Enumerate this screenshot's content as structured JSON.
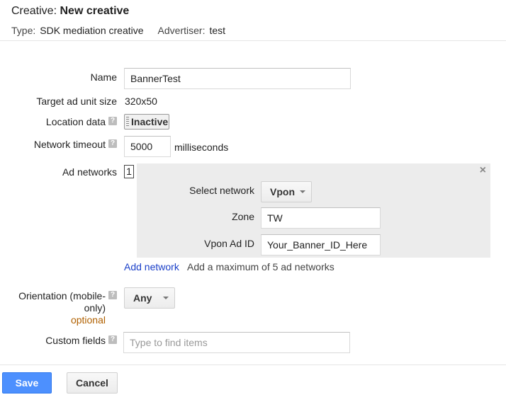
{
  "header": {
    "title_prefix": "Creative:",
    "title_name": "New creative",
    "type_label": "Type:",
    "type_value": "SDK mediation creative",
    "advertiser_label": "Advertiser:",
    "advertiser_value": "test"
  },
  "form": {
    "name": {
      "label": "Name",
      "value": "BannerTest"
    },
    "target_size": {
      "label": "Target ad unit size",
      "value": "320x50"
    },
    "location": {
      "label": "Location data",
      "toggle": "Inactive"
    },
    "timeout": {
      "label": "Network timeout",
      "value": "5000",
      "unit": "milliseconds"
    },
    "ad_networks": {
      "label": "Ad networks",
      "count": "1",
      "close_icon": "×",
      "select_network_label": "Select network",
      "select_network_value": "Vpon",
      "zone_label": "Zone",
      "zone_value": "TW",
      "vpon_id_label": "Vpon Ad ID",
      "vpon_id_value": "Your_Banner_ID_Here",
      "add_link": "Add network",
      "add_hint": "Add a maximum of 5 ad networks"
    },
    "orientation": {
      "label_line1": "Orientation (mobile-",
      "label_line2": "only)",
      "optional": "optional",
      "value": "Any"
    },
    "custom_fields": {
      "label": "Custom fields",
      "placeholder": "Type to find items"
    },
    "help_icon": "?"
  },
  "actions": {
    "save": "Save",
    "cancel": "Cancel"
  }
}
